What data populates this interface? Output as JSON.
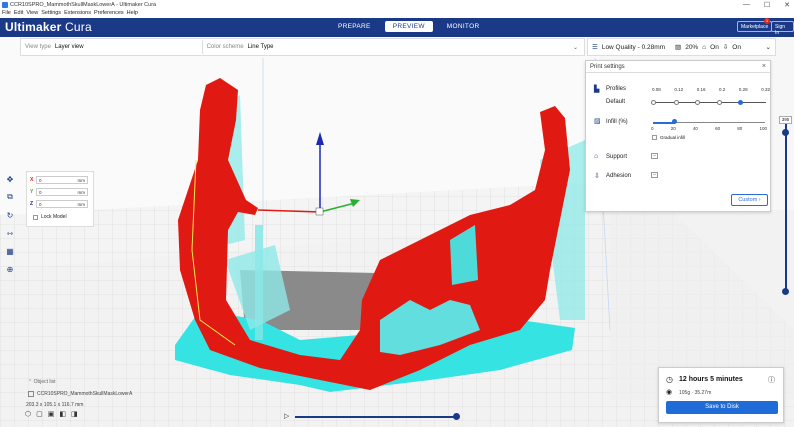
{
  "window": {
    "title": "CCR10SPRO_MammothSkullMaskLowerA - Ultimaker Cura",
    "controls": [
      "—",
      "☐",
      "✕"
    ]
  },
  "menu": [
    "File",
    "Edit",
    "View",
    "Settings",
    "Extensions",
    "Preferences",
    "Help"
  ],
  "header": {
    "brand_bold": "Ultimaker",
    "brand_light": " Cura",
    "tabs": [
      "PREPARE",
      "PREVIEW",
      "MONITOR"
    ],
    "active_tab": "PREVIEW",
    "marketplace": "Marketplace",
    "marketplace_badge": "1",
    "signin": "Sign In"
  },
  "toolbar": {
    "view_type_label": "View type",
    "view_type_value": "Layer view",
    "color_scheme_label": "Color scheme",
    "color_scheme_value": "Line Type",
    "quality": "Low Quality - 0.28mm",
    "infill": "20%",
    "support": "On",
    "adhesion": "On"
  },
  "print_settings": {
    "title": "Print settings",
    "profiles_label": "Profiles",
    "profile_default": "Default",
    "layer_heights": [
      "0.08",
      "0.12",
      "0.16",
      "0.2",
      "0.28",
      "0.32"
    ],
    "selected_layer_height": 0.28,
    "infill_label": "Infill (%)",
    "infill_ticks": [
      "0",
      "20",
      "40",
      "60",
      "80",
      "100"
    ],
    "infill_value": 20,
    "gradual_infill": "Gradual infill",
    "support_label": "Support",
    "adhesion_label": "Adhesion",
    "custom_button": "Custom"
  },
  "layer_slider": {
    "value": "395"
  },
  "move_panel": {
    "x_label": "X",
    "x_value": "0",
    "x_unit": "mm",
    "y_label": "Y",
    "y_value": "0",
    "y_unit": "mm",
    "z_label": "Z",
    "z_value": "0",
    "z_unit": "mm",
    "lock_model": "Lock Model"
  },
  "object": {
    "list_label": "Object list",
    "name": "CCR10SPRO_MammothSkullMaskLowerA",
    "dims": "203.3 x 105.1 x 116.7 mm"
  },
  "estimate": {
    "time": "12 hours 5 minutes",
    "material": "105g · 35.27m",
    "save_button": "Save to Disk"
  },
  "colors": {
    "header_blue": "#1a3a88",
    "accent_blue": "#1f6cd8",
    "model_red": "#e01a12",
    "support_cyan": "#36e3e3"
  }
}
